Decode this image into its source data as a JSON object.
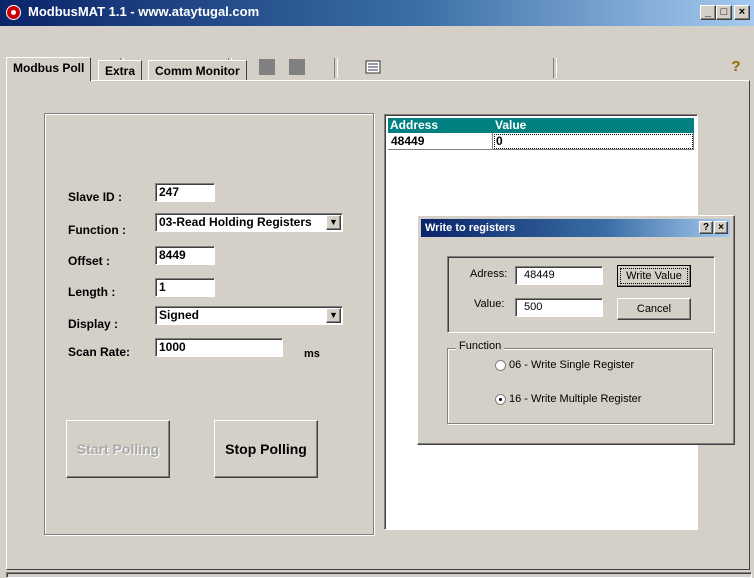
{
  "window": {
    "title": "ModbusMAT 1.1  -  www.ataytugal.com",
    "minimize": "_",
    "restore": "□",
    "close": "×"
  },
  "toolbar": {
    "icons": [
      "connect-icon",
      "refresh-icon",
      "disconnect-icon",
      "play-icon",
      "stop-icon",
      "block-icon",
      "block-icon",
      "list-icon",
      "help-icon"
    ],
    "help_glyph": "?"
  },
  "tabs": [
    {
      "label": "Modbus Poll",
      "active": true
    },
    {
      "label": "Extra",
      "active": false
    },
    {
      "label": "Comm Monitor",
      "active": false
    }
  ],
  "form": {
    "slave_id": {
      "label": "Slave ID :",
      "value": "247"
    },
    "function": {
      "label": "Function :",
      "value": "03-Read Holding Registers"
    },
    "offset": {
      "label": "Offset :",
      "value": "8449"
    },
    "length": {
      "label": "Length :",
      "value": "1"
    },
    "display": {
      "label": "Display :",
      "value": "Signed"
    },
    "scan_rate": {
      "label": "Scan Rate:",
      "value": "1000",
      "unit": "ms"
    },
    "start_button": "Start Polling",
    "stop_button": "Stop Polling"
  },
  "grid": {
    "columns": [
      "Address",
      "Value"
    ],
    "rows": [
      {
        "address": "48449",
        "value": "0"
      }
    ]
  },
  "dialog": {
    "title": "Write to registers",
    "help": "?",
    "close": "×",
    "address_label": "Adress:",
    "address_value": "48449",
    "value_label": "Value:",
    "value_value": "500",
    "write_button": "Write Value",
    "cancel_button": "Cancel",
    "function_group": "Function",
    "options": [
      {
        "label": "06 - Write Single Register",
        "selected": false
      },
      {
        "label": "16 - Write Multiple Register",
        "selected": true
      }
    ]
  },
  "colors": {
    "title_bar": "#0a246a",
    "grid_header": "#008080",
    "face": "#d4d0c8"
  }
}
